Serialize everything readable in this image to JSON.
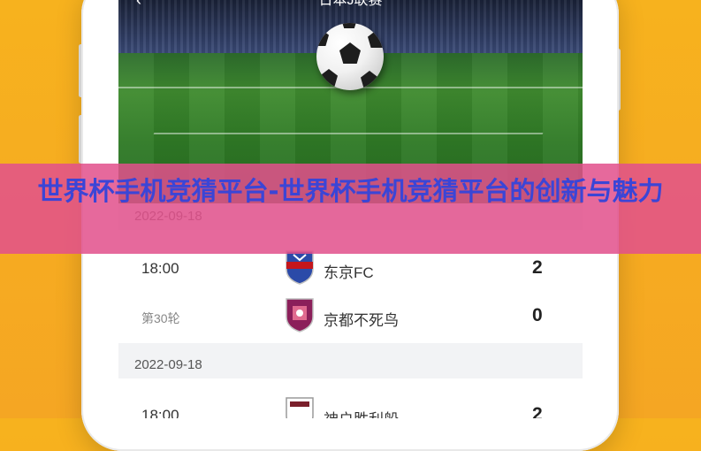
{
  "app": {
    "nav_title": "日本J联赛",
    "back_glyph": "‹"
  },
  "banner": {
    "title": "世界杯手机竞猜平台-世界杯手机竞猜平台的创新与魅力"
  },
  "schedule": [
    {
      "date": "2022-09-18",
      "time": "18:00",
      "round": "第30轮",
      "home": {
        "name": "东京FC",
        "score": "2",
        "crest_color": "#2b4aa8"
      },
      "away": {
        "name": "京都不死鸟",
        "score": "0",
        "crest_color": "#8b1f5a"
      }
    },
    {
      "date": "2022-09-18",
      "time": "18:00",
      "home": {
        "name": "神户胜利船",
        "score": "2",
        "crest_color": "#9a9a9a"
      }
    }
  ],
  "colors": {
    "background": "#f5a623",
    "banner": "#e2508c",
    "banner_text": "#3b45d6"
  }
}
